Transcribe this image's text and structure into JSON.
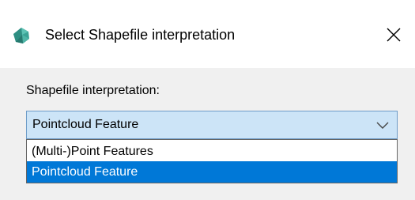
{
  "dialog": {
    "title": "Select Shapefile interpretation",
    "app_icon": "teal-gem-icon",
    "close_icon": "close-x-icon"
  },
  "form": {
    "label": "Shapefile interpretation:",
    "combo": {
      "selected": "Pointcloud Feature",
      "options": [
        "(Multi-)Point Features",
        "Pointcloud Feature"
      ],
      "highlighted_index": 1,
      "expanded": true
    }
  },
  "colors": {
    "title_bg": "#ffffff",
    "dialog_bg": "#f0f0f0",
    "combo_focus_bg": "#cce4f7",
    "combo_border": "#6e9cc8",
    "selection": "#0078d7",
    "icon": "#3aa396"
  }
}
